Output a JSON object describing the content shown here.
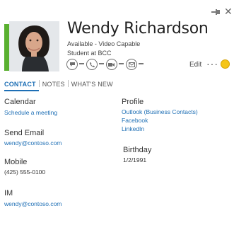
{
  "contact": {
    "name": "Wendy Richardson",
    "status": "Available - Video Capable",
    "title": "Student at BCC"
  },
  "header": {
    "edit_label": "Edit",
    "more_label": "···"
  },
  "tabs": [
    {
      "label": "CONTACT",
      "active": true
    },
    {
      "label": "NOTES",
      "active": false
    },
    {
      "label": "WHAT'S NEW",
      "active": false
    }
  ],
  "left": {
    "calendar_label": "Calendar",
    "calendar_link": "Schedule a meeting",
    "email_label": "Send Email",
    "email_value": "wendy@contoso.com",
    "mobile_label": "Mobile",
    "mobile_value": "(425) 555-0100",
    "im_label": "IM",
    "im_value": "wendy@contoso.com"
  },
  "right": {
    "profile_label": "Profile",
    "profile_links": [
      "Outlook (Business Contacts)",
      "Facebook",
      "LinkedIn"
    ],
    "birthday_label": "Birthday",
    "birthday_value": "1/2/1991"
  },
  "colors": {
    "presence": "#5ab030",
    "accent": "#1e6fb5"
  }
}
